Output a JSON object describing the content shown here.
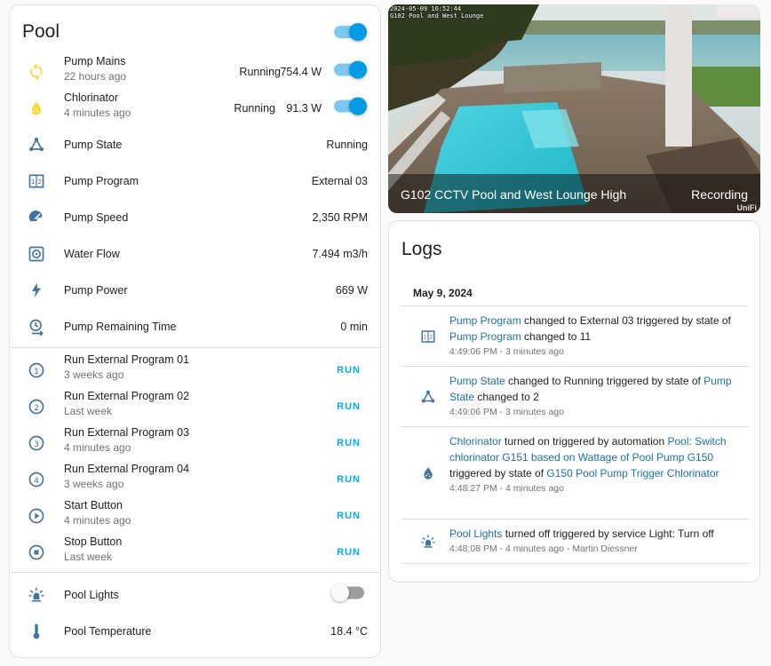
{
  "pool": {
    "title": "Pool",
    "main_toggle": "on",
    "rows": [
      {
        "name": "Pump Mains",
        "sub": "22 hours ago",
        "state": "Running",
        "value": "754.4 W",
        "icon": "sync-icon",
        "toggle": "on"
      },
      {
        "name": "Chlorinator",
        "sub": "4 minutes ago",
        "state": "Running",
        "value": "91.3 W",
        "icon": "water-drop-icon",
        "toggle": "on"
      },
      {
        "name": "Pump State",
        "value": "Running",
        "icon": "hub-icon"
      },
      {
        "name": "Pump Program",
        "value": "External 03",
        "icon": "program-icon"
      },
      {
        "name": "Pump Speed",
        "value": "2,350 RPM",
        "icon": "speedometer-icon"
      },
      {
        "name": "Water Flow",
        "value": "7.494 m3/h",
        "icon": "pump-icon"
      },
      {
        "name": "Pump Power",
        "value": "669 W",
        "icon": "lightning-icon"
      },
      {
        "name": "Pump Remaining Time",
        "value": "0 min",
        "icon": "timer-icon"
      }
    ],
    "programs": [
      {
        "name": "Run External Program 01",
        "sub": "3 weeks ago",
        "icon": "numeric-1-icon",
        "action": "RUN"
      },
      {
        "name": "Run External Program 02",
        "sub": "Last week",
        "icon": "numeric-2-icon",
        "action": "RUN"
      },
      {
        "name": "Run External Program 03",
        "sub": "4 minutes ago",
        "icon": "numeric-3-icon",
        "action": "RUN"
      },
      {
        "name": "Run External Program 04",
        "sub": "3 weeks ago",
        "icon": "numeric-4-icon",
        "action": "RUN"
      },
      {
        "name": "Start Button",
        "sub": "4 minutes ago",
        "icon": "play-icon",
        "action": "RUN"
      },
      {
        "name": "Stop Button",
        "sub": "Last week",
        "icon": "stop-icon",
        "action": "RUN"
      }
    ],
    "lights": {
      "name": "Pool Lights",
      "icon": "light-icon",
      "toggle": "off"
    },
    "temperature": {
      "name": "Pool Temperature",
      "value": "18.4 °C",
      "icon": "thermometer-icon"
    }
  },
  "camera": {
    "title": "G102 CCTV Pool and West Lounge High",
    "status": "Recording",
    "stamp_line1": "2024-05-09 16:52:44",
    "stamp_line2": "G102 Pool and West Lounge",
    "brand": "UniFi"
  },
  "logs": {
    "title": "Logs",
    "date": "May 9, 2024",
    "entries": [
      {
        "icon": "program-icon",
        "e1": "Pump Program",
        "t1": " changed to External 03 triggered by state of ",
        "e2": "Pump Program",
        "t2": " changed to 11",
        "time": "4:49:06 PM - 3 minutes ago"
      },
      {
        "icon": "hub-icon",
        "e1": "Pump State",
        "t1": " changed to Running triggered by state of ",
        "e2": "Pump State",
        "t2": " changed to 2",
        "time": "4:49:06 PM - 3 minutes ago"
      },
      {
        "icon": "water-drop-icon",
        "e1": "Chlorinator",
        "t1": " turned on triggered by automation ",
        "e2": "Pool: Switch chlorinator G151 based on Wattage of Pool Pump G150",
        "t2": " triggered by state of ",
        "e3": "G150 Pool Pump Trigger Chlorinator",
        "time": "4:48:27 PM - 4 minutes ago"
      },
      {
        "icon": "light-icon",
        "e1": "Pool Lights",
        "t1": " turned off triggered by service Light: Turn off",
        "time": "4:48:08 PM - 4 minutes ago - Martin Diessner"
      }
    ]
  },
  "colors": {
    "accent": "#03a9f4",
    "toggle_on": "#039be5",
    "icon": "#44739e",
    "icon_active": "#fdd835",
    "link": "#1e6fa8"
  }
}
